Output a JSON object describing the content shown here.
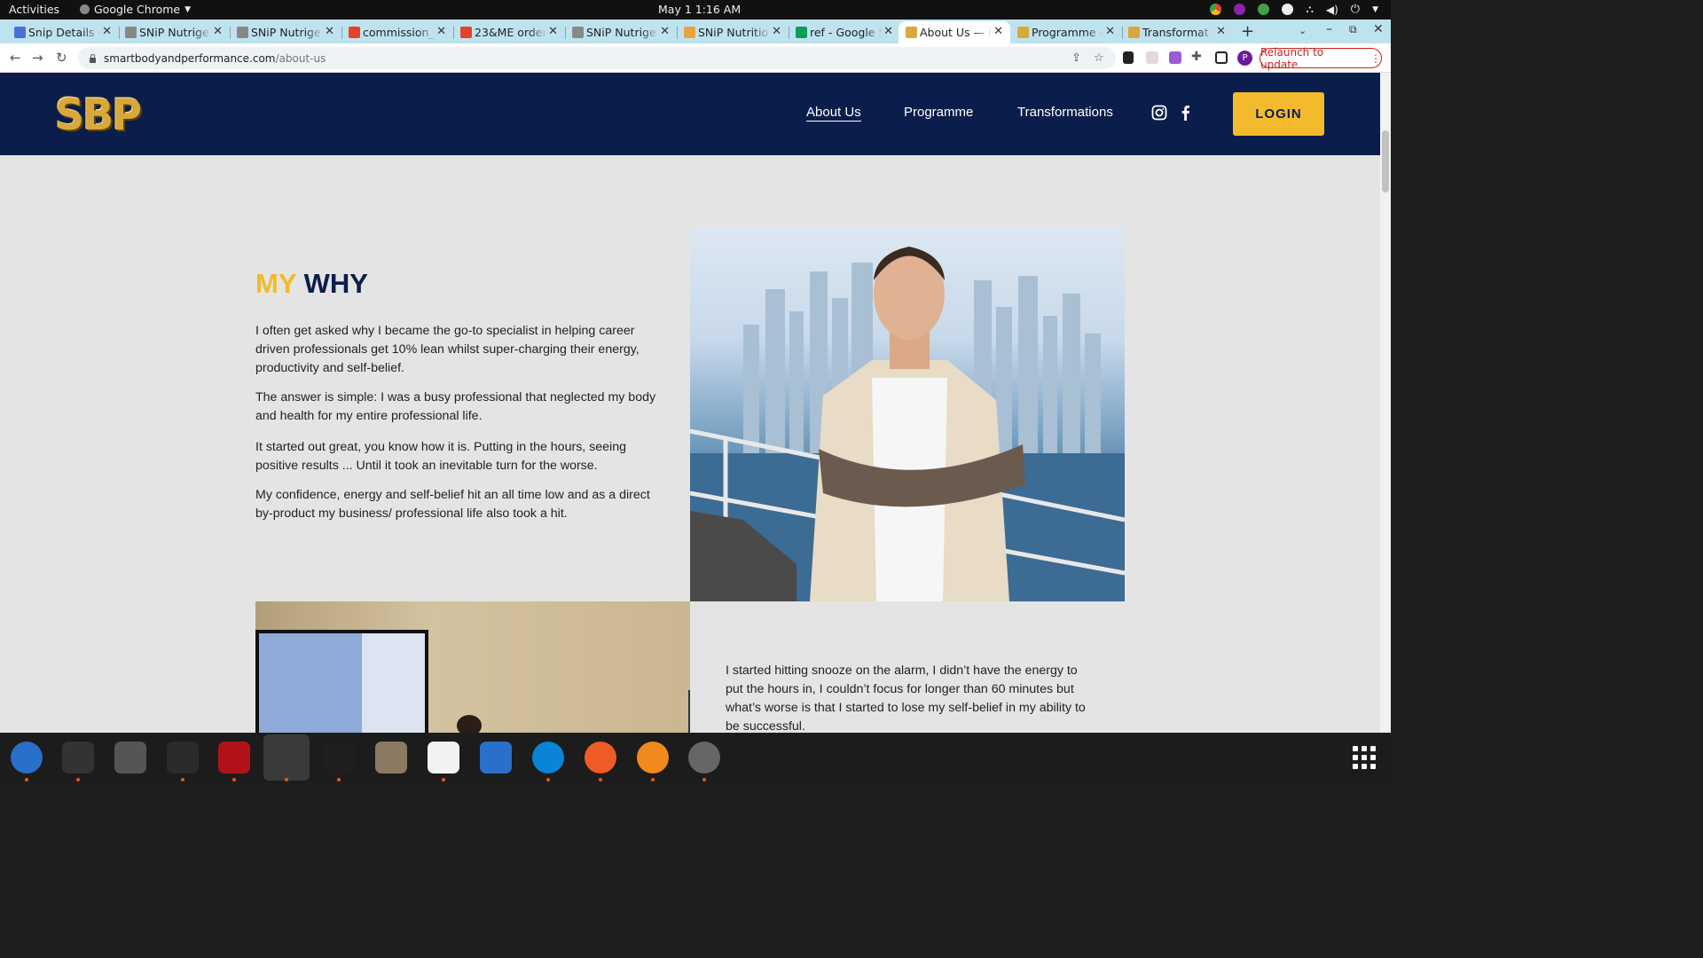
{
  "system": {
    "activities": "Activities",
    "app_name": "Google Chrome",
    "clock": "May 1  1:16 AM"
  },
  "tabs": [
    {
      "label": "Snip Details -",
      "favicon_color": "#4a6fd8"
    },
    {
      "label": "SNiP Nutrige",
      "favicon_color": "#888888"
    },
    {
      "label": "SNiP Nutrige",
      "favicon_color": "#888888"
    },
    {
      "label": "commission_",
      "favicon_color": "#e24329"
    },
    {
      "label": "23&ME order",
      "favicon_color": "#e24329"
    },
    {
      "label": "SNiP Nutrige",
      "favicon_color": "#888888"
    },
    {
      "label": "SNiP Nutritio",
      "favicon_color": "#e8a33d"
    },
    {
      "label": "ref - Google S",
      "favicon_color": "#0f9d58"
    },
    {
      "label": "About Us — I",
      "favicon_color": "#d8a83c",
      "active": true
    },
    {
      "label": "Programme -",
      "favicon_color": "#d8a83c"
    },
    {
      "label": "Transformat",
      "favicon_color": "#d8a83c"
    }
  ],
  "browser": {
    "url_host": "smartbodyandperformance.com",
    "url_path": "/about-us",
    "relaunch_label": "Relaunch to update"
  },
  "site": {
    "logo": "SBP",
    "nav": [
      "About Us",
      "Programme",
      "Transformations"
    ],
    "login": "LOGIN",
    "colors": {
      "navy": "#0b1d4b",
      "gold": "#f2ba2c"
    }
  },
  "content": {
    "heading_accent": "MY",
    "heading_main": "WHY",
    "paragraphs": [
      "I often get asked why I became the go-to specialist in helping career driven professionals get 10% lean whilst super-charging their energy, productivity and self-belief.",
      "The answer is simple: I was a busy professional that neglected my body and health for my entire professional life.",
      "It started out great, you know how it is. Putting in the hours, seeing positive results ... Until it took an inevitable turn for the worse.",
      "My confidence, energy and self-belief hit an all time low and as a direct by-product my business/ professional life also took a hit."
    ],
    "paragraph_right": "I started hitting snooze on the alarm, I didn’t have the energy to put the hours in, I couldn’t focus for longer than 60 minutes but what’s worse is that I started to lose my self-belief in my ability to be successful."
  },
  "dock": [
    {
      "name": "thunderbird",
      "color": "#2a6fc9"
    },
    {
      "name": "terminal",
      "color": "#333333"
    },
    {
      "name": "calculator",
      "color": "#555555"
    },
    {
      "name": "system-monitor",
      "color": "#2b2b2b"
    },
    {
      "name": "filezilla",
      "color": "#b1121a"
    },
    {
      "name": "chrome",
      "color": "#3a3a3a"
    },
    {
      "name": "vscode",
      "color": "#1e1e1e"
    },
    {
      "name": "files",
      "color": "#8a7a62"
    },
    {
      "name": "text-editor",
      "color": "#f2f2f2"
    },
    {
      "name": "libreoffice-writer",
      "color": "#2a6fc9"
    },
    {
      "name": "skype",
      "color": "#0a84d6"
    },
    {
      "name": "postman",
      "color": "#ef5b25"
    },
    {
      "name": "firefox",
      "color": "#f08a1c"
    },
    {
      "name": "disks",
      "color": "#666666"
    }
  ]
}
